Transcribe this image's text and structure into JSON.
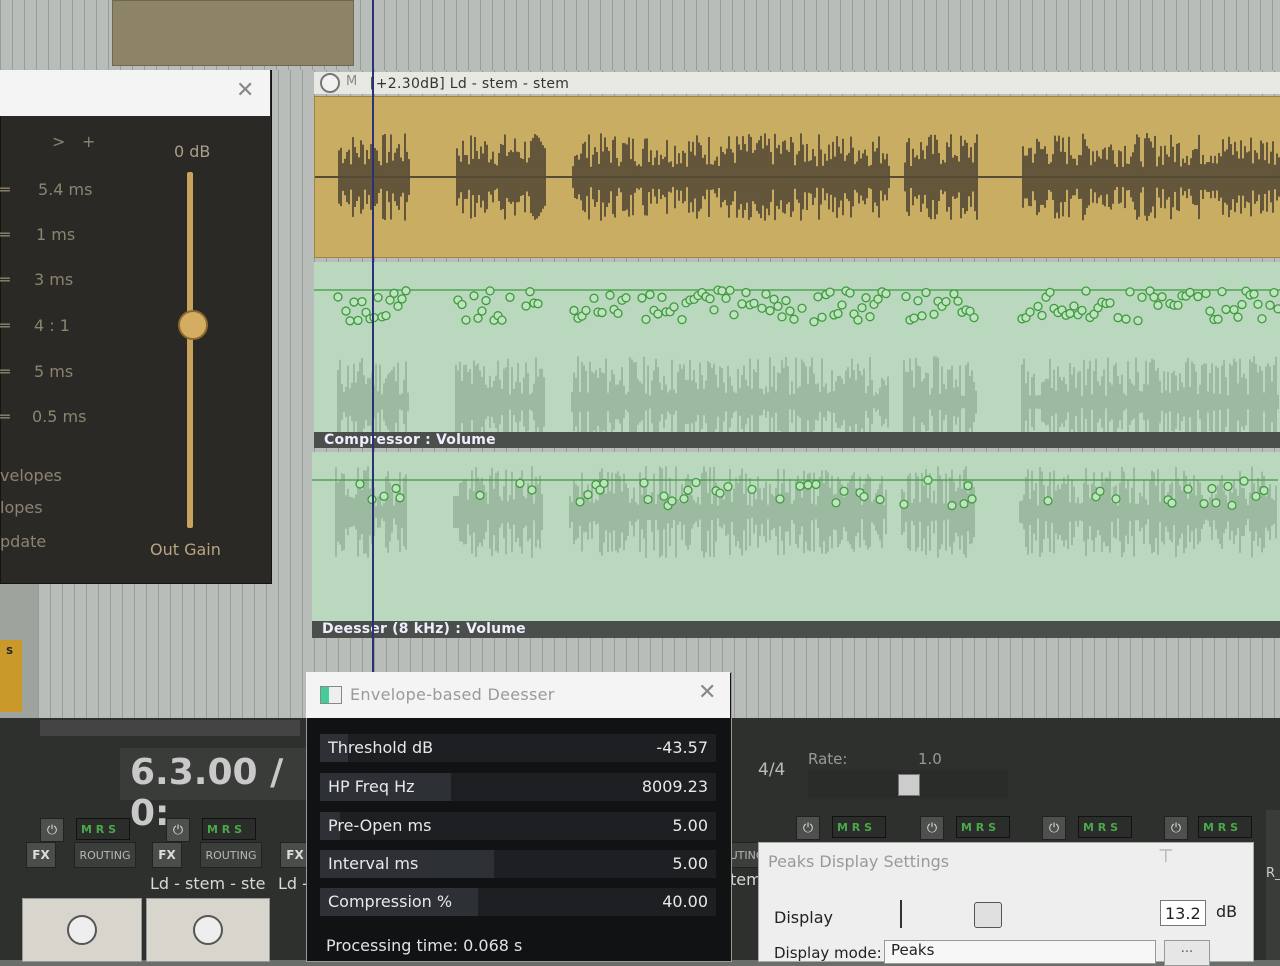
{
  "compressor": {
    "nav": [
      ">",
      "+"
    ],
    "params": [
      "5.4 ms",
      "1 ms",
      "3 ms",
      "4 : 1",
      "5 ms",
      "0.5 ms"
    ],
    "options": [
      "velopes",
      "lopes",
      "pdate"
    ],
    "slider_top": "0 dB",
    "slider_label": "Out Gain"
  },
  "item": {
    "mute": "M",
    "title": "[+2.30dB] Ld - stem - stem"
  },
  "envelopes": {
    "comp_label": "Compressor : Volume",
    "deesser_label": "Deesser (8 kHz) : Volume"
  },
  "transport": {
    "timecode": "6.3.00 / 0:",
    "time_sig": "4/4",
    "rate_label": "Rate:",
    "rate_value": "1.0"
  },
  "mixer": {
    "fx": "FX",
    "routing": "ROUTING",
    "mrs": "M R S",
    "power": "⏻",
    "track_name": "Ld - stem - ste",
    "track_name_2": "Ld -",
    "track_name_3": "tem",
    "routing_partial": "UTING",
    "left_badge": "S",
    "right_partial": "R_"
  },
  "deesser": {
    "title": "Envelope-based Deesser",
    "params": [
      {
        "label": "Threshold dB",
        "value": "-43.57",
        "fill": 0.07
      },
      {
        "label": "HP Freq Hz",
        "value": "8009.23",
        "fill": 0.33
      },
      {
        "label": "Pre-Open ms",
        "value": "5.00",
        "fill": 0.05
      },
      {
        "label": "Interval ms",
        "value": "5.00",
        "fill": 0.44
      },
      {
        "label": "Compression %",
        "value": "40.00",
        "fill": 0.4
      }
    ],
    "processing_time": "Processing time: 0.068 s"
  },
  "peaks": {
    "title": "Peaks Display Settings",
    "display_label": "Display",
    "db_value": "13.2",
    "db_unit": "dB",
    "mode_label": "Display mode:",
    "mode_value": "Peaks",
    "mode_btn": "..."
  },
  "colors": {
    "item_gold": "#c9ad62",
    "envelope_green": "#3f9a3f",
    "compressor_bg": "#2b2926",
    "deesser_bg": "#111214",
    "cursor": "#2b3178"
  }
}
